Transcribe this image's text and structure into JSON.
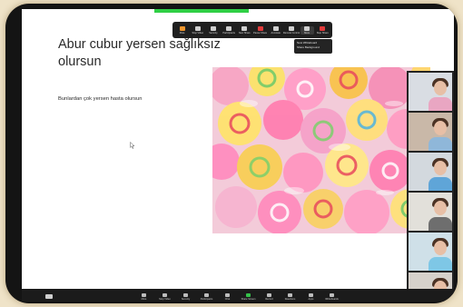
{
  "top_toolbar": {
    "buttons": [
      {
        "label": "Mute",
        "icon": "mic-icon"
      },
      {
        "label": "Stop Video",
        "icon": "video-icon"
      },
      {
        "label": "Security",
        "icon": "shield-icon"
      },
      {
        "label": "Participants",
        "icon": "participants-icon"
      },
      {
        "label": "New Share",
        "icon": "share-icon"
      },
      {
        "label": "Pause Share",
        "icon": "pause-icon"
      },
      {
        "label": "Annotate",
        "icon": "pencil-icon"
      },
      {
        "label": "Remote Control",
        "icon": "remote-icon"
      },
      {
        "label": "More",
        "icon": "more-icon"
      },
      {
        "label": "Stop Share",
        "icon": "stop-icon"
      }
    ]
  },
  "dropdown": {
    "items": [
      "New Whiteboard",
      "Share Background"
    ]
  },
  "slide": {
    "title": "Abur cubur yersen sağlıksız olursun",
    "body": "Bunlardan çok yersen hasta olursun"
  },
  "bottom_toolbar": {
    "buttons": [
      {
        "label": "Mute"
      },
      {
        "label": "Stop Video"
      },
      {
        "label": "Security"
      },
      {
        "label": "Participants"
      },
      {
        "label": "Chat"
      },
      {
        "label": "Share Screen"
      },
      {
        "label": "Record"
      },
      {
        "label": "Reactions"
      },
      {
        "label": "Apps"
      },
      {
        "label": "Whiteboards"
      }
    ]
  },
  "colors": {
    "share_green": "#2fcf45",
    "stop_red": "#e23b3b",
    "toolbar_dark": "#1f1f1f"
  }
}
